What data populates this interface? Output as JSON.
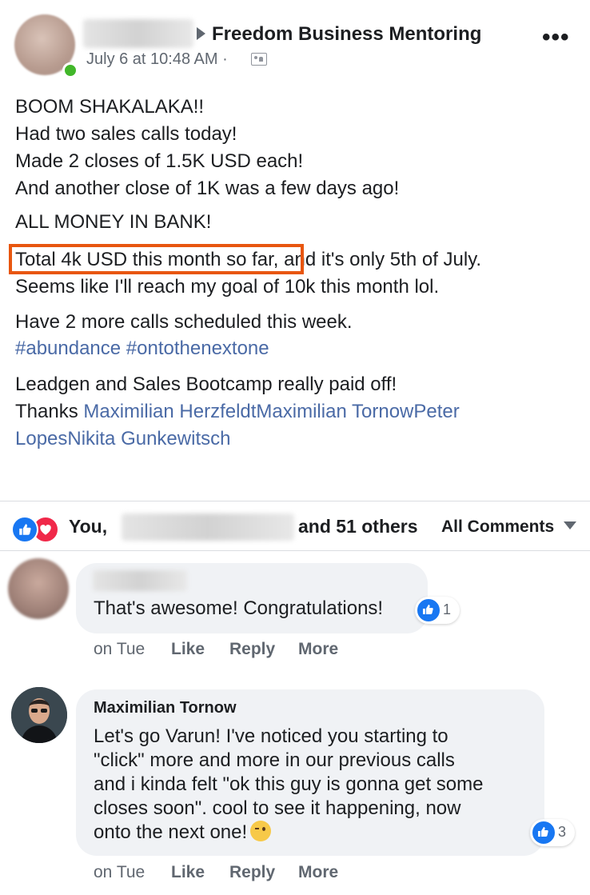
{
  "post": {
    "group_name": "Freedom Business Mentoring",
    "timestamp": "July 6 at 10:48 AM ·",
    "more_label": "•••",
    "lines": [
      "BOOM SHAKALAKA!!",
      "Had two sales calls today!",
      "Made 2 closes of 1.5K USD each!",
      "And another close of 1K was a few days ago!",
      "ALL MONEY IN BANK!",
      "Seems like I'll reach my goal of 10k this month lol.",
      "Have 2 more calls scheduled this week.",
      "Leadgen and Sales Bootcamp really paid off!"
    ],
    "highlight_text": "Total 4k USD this month so far,",
    "highlight_rest": " and it's only 5th of July.",
    "hashtags": "#abundance #ontothenextone",
    "thanks_label": "Thanks ",
    "thanks_links_1": "Maximilian HerzfeldtMaximilian TornowPeter",
    "thanks_links_2": "LopesNikita Gunkewitsch"
  },
  "reactions": {
    "you": "You,",
    "others": "and 51 others",
    "filter": "All Comments"
  },
  "comments": [
    {
      "text": "That's awesome! Congratulations!",
      "like_count": "1",
      "time": "on Tue",
      "like": "Like",
      "reply": "Reply",
      "more": "More"
    },
    {
      "author": "Maximilian Tornow",
      "lines": [
        "Let's go Varun! I've noticed you starting to",
        "\"click\" more and more in our previous calls",
        "and i kinda felt \"ok this guy is gonna get some",
        "closes soon\". cool to see it happening, now",
        "onto the next one!"
      ],
      "like_count": "3",
      "time": "on Tue",
      "like": "Like",
      "reply": "Reply",
      "more": "More"
    }
  ],
  "colors": {
    "link": "#4a6aa6",
    "highlight": "#e8560f",
    "like_blue": "#1877f2",
    "love_red": "#f02849"
  }
}
